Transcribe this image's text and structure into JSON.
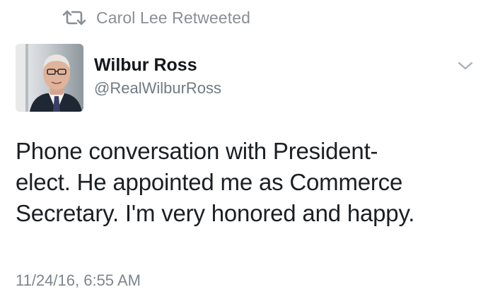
{
  "retweet": {
    "icon": "retweet-icon",
    "label": "Carol Lee Retweeted"
  },
  "author": {
    "name": "Wilbur Ross",
    "handle": "@RealWilburRoss",
    "avatar_icon": "profile-photo"
  },
  "menu": {
    "icon": "chevron-down-icon"
  },
  "tweet": {
    "lines": [
      "Phone conversation with President-",
      "elect. He appointed me as Commerce",
      "Secretary.  I'm very honored and happy."
    ],
    "timestamp": "11/24/16, 6:55 AM"
  },
  "colors": {
    "secondary_text": "#8a8f94",
    "primary_text": "#14171a",
    "background": "#ffffff"
  }
}
